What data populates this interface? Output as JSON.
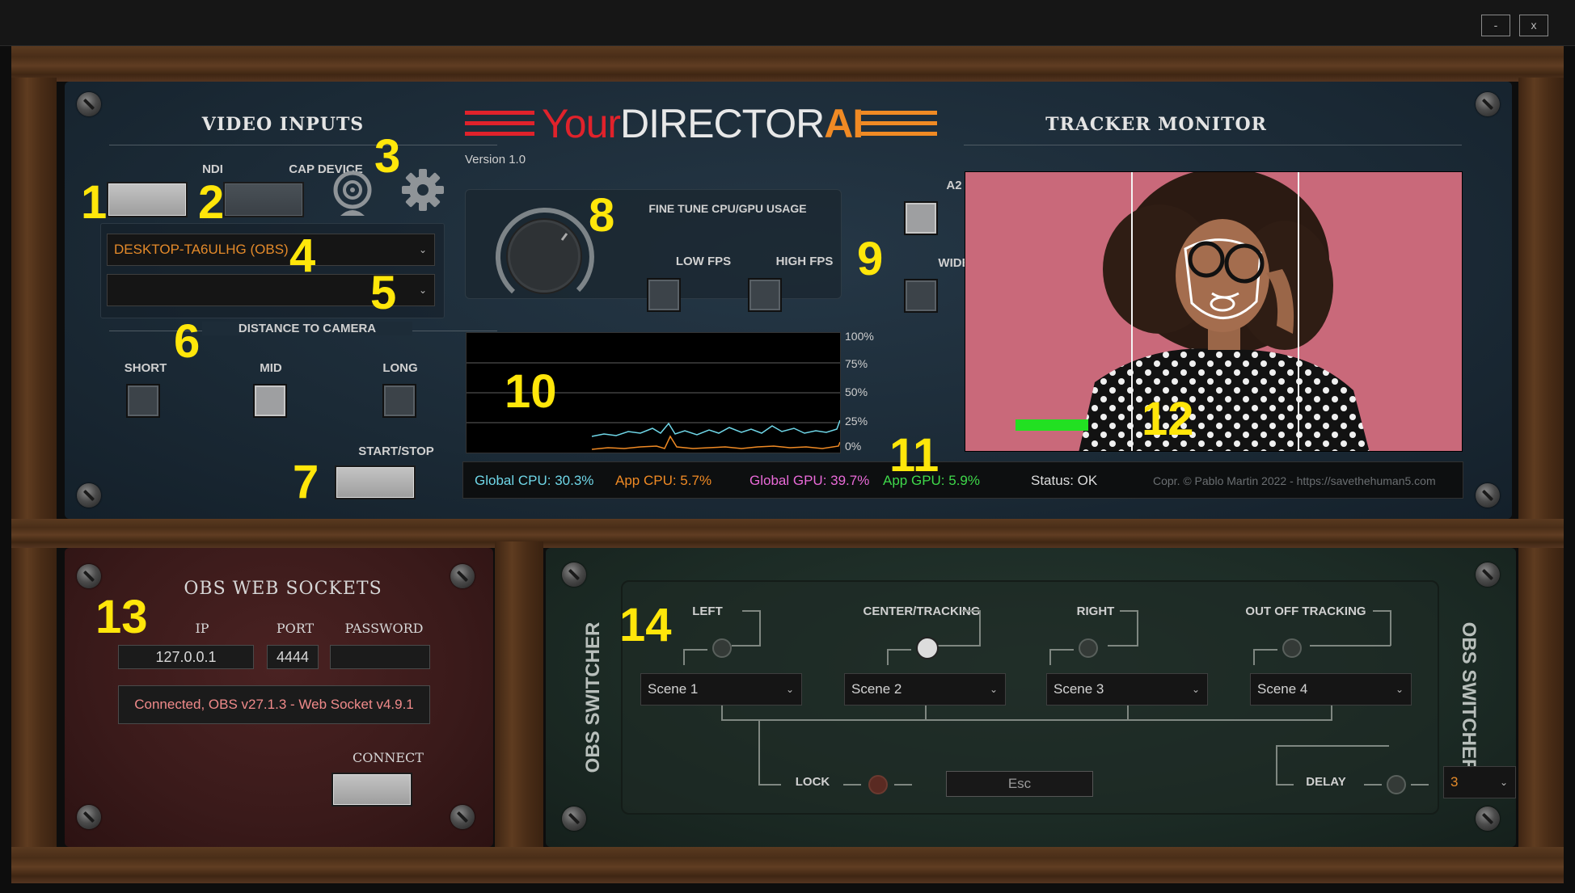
{
  "window": {
    "minimize": "-",
    "close": "x"
  },
  "brand": {
    "your": "Your",
    "director": "DIRECTOR",
    "ai": "AI",
    "version": "Version 1.0",
    "red": "#e0222b",
    "orange": "#f08a24"
  },
  "video_inputs": {
    "title": "VIDEO INPUTS",
    "ndi": "NDI",
    "cap_device": "CAP DEVICE",
    "source_select": "DESKTOP-TA6ULHG (OBS)",
    "device_select": "",
    "distance_label": "DISTANCE TO CAMERA",
    "short": "SHORT",
    "mid": "MID",
    "long": "LONG",
    "start_stop": "START/STOP",
    "webcam_icon": "webcam-icon",
    "settings_icon": "gear-icon"
  },
  "tuning": {
    "title": "FINE TUNE CPU/GPU USAGE",
    "low_fps": "LOW FPS",
    "high_fps": "HIGH FPS",
    "a2": "A2",
    "wide": "WIDE"
  },
  "usage_chart": {
    "y_ticks": [
      "100%",
      "75%",
      "50%",
      "25%",
      "0%"
    ]
  },
  "stats": {
    "global_cpu": "Global CPU: 30.3%",
    "app_cpu": "App CPU: 5.7%",
    "global_gpu": "Global GPU: 39.7%",
    "app_gpu": "App GPU: 5.9%",
    "status": "Status: OK",
    "copyright": "Copr. © Pablo Martin 2022 - https://savethehuman5.com"
  },
  "tracker": {
    "title": "TRACKER MONITOR",
    "bg_color": "#c9697a"
  },
  "obs_sockets": {
    "title": "OBS WEB SOCKETS",
    "ip_label": "IP",
    "port_label": "PORT",
    "password_label": "PASSWORD",
    "ip": "127.0.0.1",
    "port": "4444",
    "password": "",
    "status": "Connected, OBS v27.1.3 - Web Socket v4.9.1",
    "connect": "CONNECT"
  },
  "obs_switcher": {
    "side_label": "OBS SWITCHER",
    "columns": [
      {
        "label": "LEFT",
        "scene": "Scene 1"
      },
      {
        "label": "CENTER/TRACKING",
        "scene": "Scene 2"
      },
      {
        "label": "RIGHT",
        "scene": "Scene 3"
      },
      {
        "label": "OUT OFF TRACKING",
        "scene": "Scene 4"
      }
    ],
    "lock": "LOCK",
    "lock_key": "Esc",
    "delay": "DELAY",
    "delay_value": "3"
  },
  "markers": [
    "1",
    "2",
    "3",
    "4",
    "5",
    "6",
    "7",
    "8",
    "9",
    "10",
    "11",
    "12",
    "13",
    "14"
  ]
}
